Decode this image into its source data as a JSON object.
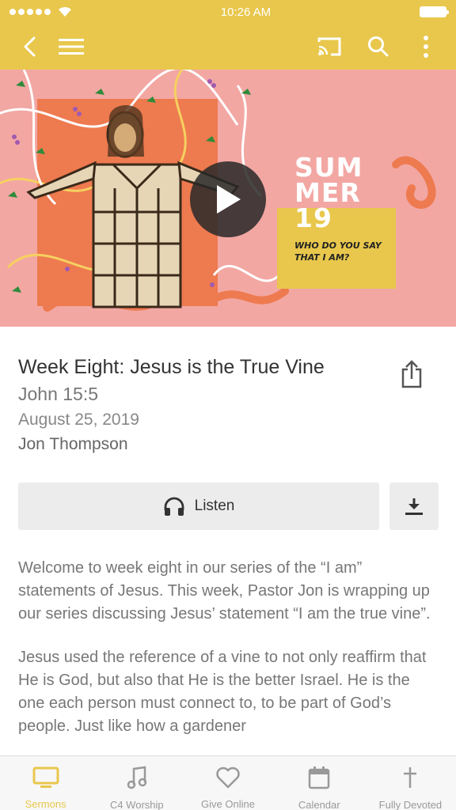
{
  "status_bar": {
    "time": "10:26 AM"
  },
  "nav": {
    "icons": [
      "chevron-left-icon",
      "hamburger-menu-icon",
      "cast-icon",
      "search-icon",
      "more-vertical-icon"
    ]
  },
  "hero": {
    "series_title": "SUM MER 19",
    "tagline": "WHO DO YOU SAY THAT I AM?"
  },
  "sermon": {
    "title": "Week Eight: Jesus is the True Vine",
    "scripture": "John 15:5",
    "date": "August 25, 2019",
    "speaker": "Jon Thompson",
    "listen_label": "Listen",
    "description": [
      "Welcome to week eight in our series of the “I am” statements of Jesus. This week, Pastor Jon is wrapping up our series discussing Jesus’ statement “I am the true vine”.",
      "Jesus used the reference of a vine to not only reaffirm that He is God, but also that He is the better Israel. He is the one each person must connect to, to be part of God’s people. Just like how a gardener"
    ]
  },
  "tabs": [
    {
      "label": "Sermons",
      "icon": "monitor-icon",
      "active": true
    },
    {
      "label": "C4 Worship",
      "icon": "music-note-icon",
      "active": false
    },
    {
      "label": "Give Online",
      "icon": "heart-icon",
      "active": false
    },
    {
      "label": "Calendar",
      "icon": "calendar-icon",
      "active": false
    },
    {
      "label": "Fully Devoted",
      "icon": "cross-icon",
      "active": false
    }
  ],
  "colors": {
    "accent": "#e8c74c",
    "hero_background": "#f2a7a3",
    "hero_orange": "#ee7a4f"
  }
}
